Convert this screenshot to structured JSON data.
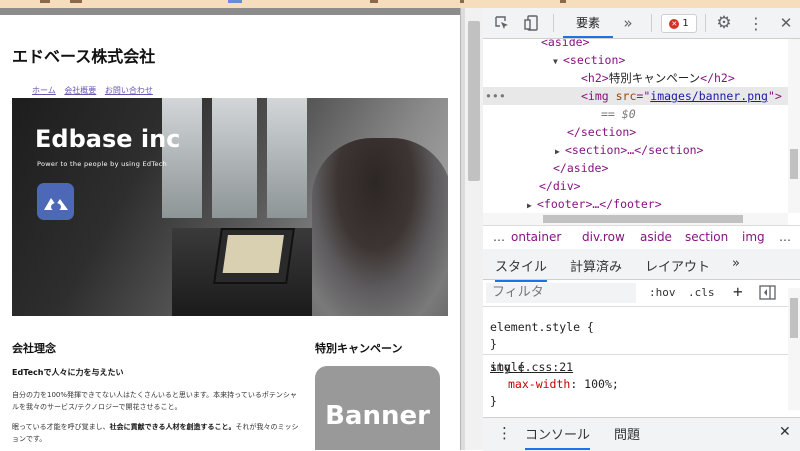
{
  "page": {
    "site_title": "エドベース株式会社",
    "nav": [
      "ホーム",
      "会社概要",
      "お問い合わせ"
    ],
    "hero_title": "Edbase inc",
    "hero_subtitle": "Power to the people by using EdTech",
    "philosophy_heading": "会社理念",
    "mission_heading": "EdTechで人々に力を与えたい",
    "paragraph1": "自分の力を100%発揮できてない人はたくさんいると思います。本来持っているポテンシャルを我々のサービス/テクノロジーで開花させること。",
    "paragraph2_start": "眠っている才能を呼び覚まし、",
    "paragraph2_bold": "社会に貢献できる人材を創造すること。",
    "paragraph2_end": "それが我々のミッションです。",
    "campaign_heading": "特別キャンペーン",
    "banner_text": "Banner"
  },
  "devtools": {
    "elements_tab": "要素",
    "more_tabs": "»",
    "error_count": "1",
    "dom_lines": {
      "aside_open": "<aside>",
      "section_open": "<section>",
      "h2_open": "<h2>",
      "h2_text": "特別キャンペーン",
      "h2_close": "</h2>",
      "img_tag": "<img ",
      "img_attr": "src",
      "img_eq": "=\"",
      "img_src": "images/banner.png",
      "img_end": "\">",
      "dollar": "== $0",
      "section_close": "</section>",
      "section_collapsed": "<section>…</section>",
      "aside_close": "</aside>",
      "div_close": "</div>",
      "footer": "<footer>…</footer>"
    },
    "breadcrumbs": [
      "…",
      "ontainer",
      "div.row",
      "aside",
      "section",
      "img",
      "…"
    ],
    "style_tabs": [
      "スタイル",
      "計算済み",
      "レイアウト",
      "»"
    ],
    "filter_placeholder": "フィルタ",
    "hov": ":hov",
    "cls": ".cls",
    "element_style": "element.style {",
    "close_brace": "}",
    "img_selector": "img {",
    "rule_source": "style.css:21",
    "rule_prop": "max-width",
    "rule_value": "100%;",
    "drawer_tabs": [
      "コンソール",
      "問題"
    ]
  }
}
